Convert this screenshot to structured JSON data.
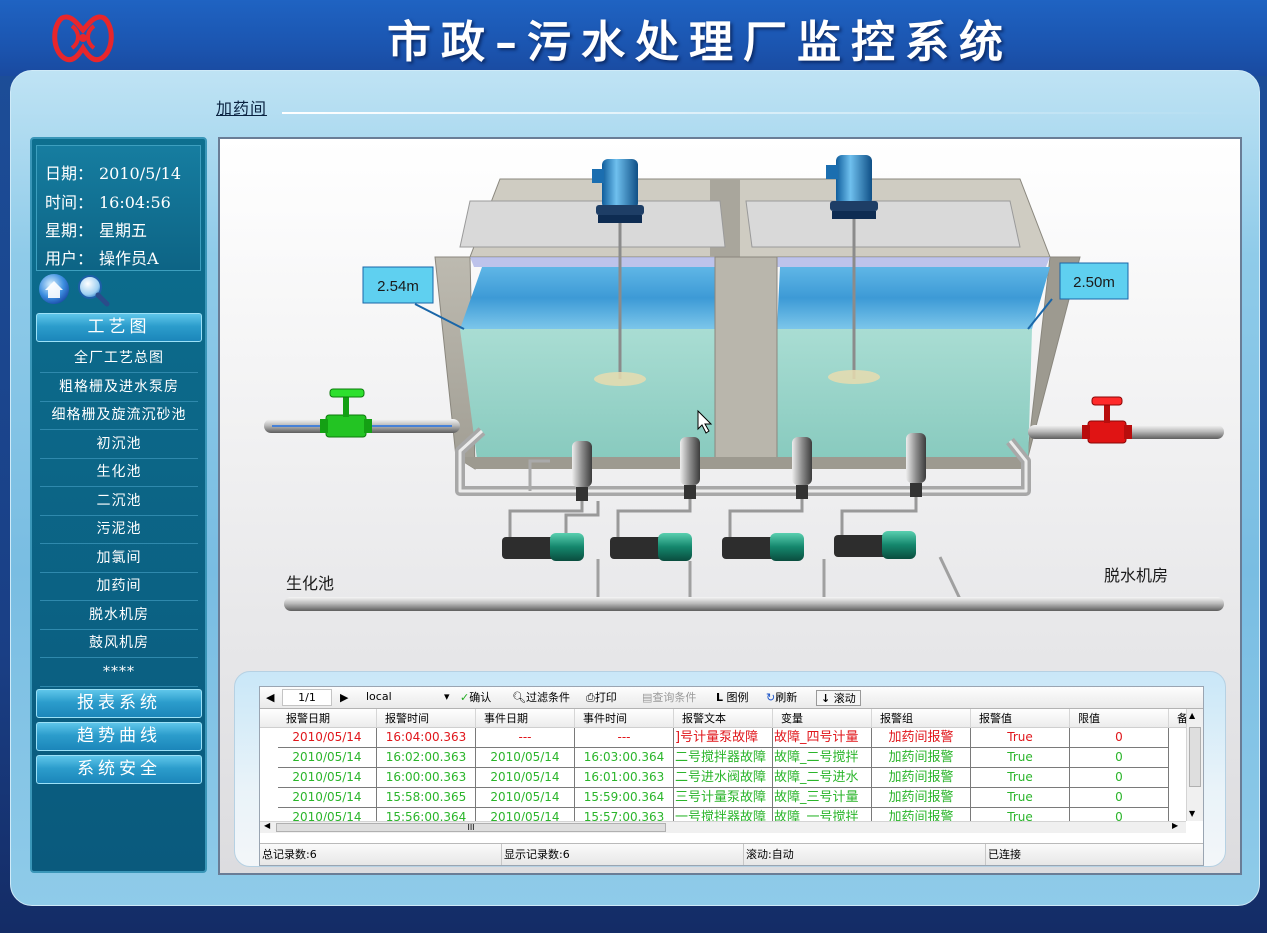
{
  "app": {
    "title": "市政–污水处理厂监控系统"
  },
  "breadcrumb": {
    "current": "加药间"
  },
  "info": {
    "date_label": "日期：",
    "date_value": "2010/5/14",
    "time_label": "时间：",
    "time_value": "16:04:56",
    "weekday_label": "星期：",
    "weekday_value": "星期五",
    "user_label": "用户：",
    "user_value": "操作员A"
  },
  "toolbar_icons": [
    "home-icon",
    "magnifier-icon"
  ],
  "sidebar": {
    "section_process": "工艺图",
    "items": [
      {
        "label": "全厂工艺总图"
      },
      {
        "label": "粗格栅及进水泵房"
      },
      {
        "label": "细格栅及旋流沉砂池"
      },
      {
        "label": "初沉池"
      },
      {
        "label": "生化池"
      },
      {
        "label": "二沉池"
      },
      {
        "label": "污泥池"
      },
      {
        "label": "加氯间"
      },
      {
        "label": "加药间"
      },
      {
        "label": "脱水机房"
      },
      {
        "label": "鼓风机房"
      },
      {
        "label": "****"
      }
    ],
    "section_reports": "报表系统",
    "section_trends": "趋势曲线",
    "section_security": "系统安全"
  },
  "process": {
    "level_left": "2.54m",
    "level_right": "2.50m",
    "label_left": "生化池",
    "label_right": "脱水机房",
    "valve_left_color": "#22cc22",
    "valve_right_color": "#dd1111",
    "water_color": "#9fd8d0"
  },
  "alarm": {
    "toolbar": {
      "page": "1/1",
      "server": "local",
      "confirm": "确认",
      "filter": "过滤条件",
      "print": "打印",
      "query": "查询条件",
      "legend": "图例",
      "refresh": "刷新",
      "scroll": "滚动"
    },
    "columns": [
      "报警日期",
      "报警时间",
      "事件日期",
      "事件时间",
      "报警文本",
      "变量",
      "报警组",
      "报警值",
      "限值",
      "备"
    ],
    "rows": [
      {
        "date": "2010/05/14",
        "time": "16:04:00.363",
        "edate": "---",
        "etime": "---",
        "text": "]号计量泵故障",
        "var": "故障_四号计量",
        "group": "加药间报警",
        "value": "True",
        "limit": "0",
        "color": "#e0161b"
      },
      {
        "date": "2010/05/14",
        "time": "16:02:00.363",
        "edate": "2010/05/14",
        "etime": "16:03:00.364",
        "text": "二号搅拌器故障",
        "var": "故障_二号搅拌",
        "group": "加药间报警",
        "value": "True",
        "limit": "0",
        "color": "#2bb52b"
      },
      {
        "date": "2010/05/14",
        "time": "16:00:00.363",
        "edate": "2010/05/14",
        "etime": "16:01:00.363",
        "text": "二号进水阀故障",
        "var": "故障_二号进水",
        "group": "加药间报警",
        "value": "True",
        "limit": "0",
        "color": "#2bb52b"
      },
      {
        "date": "2010/05/14",
        "time": "15:58:00.365",
        "edate": "2010/05/14",
        "etime": "15:59:00.364",
        "text": "三号计量泵故障",
        "var": "故障_三号计量",
        "group": "加药间报警",
        "value": "True",
        "limit": "0",
        "color": "#2bb52b"
      },
      {
        "date": "2010/05/14",
        "time": "15:56:00.364",
        "edate": "2010/05/14",
        "etime": "15:57:00.363",
        "text": "一号搅拌器故障",
        "var": "故障_一号搅拌",
        "group": "加药间报警",
        "value": "True",
        "limit": "0",
        "color": "#2bb52b"
      }
    ],
    "hscroll_mark": "III",
    "status": {
      "total": "总记录数:6",
      "shown": "显示记录数:6",
      "scroll": "滚动:自动",
      "conn": "已连接"
    }
  }
}
